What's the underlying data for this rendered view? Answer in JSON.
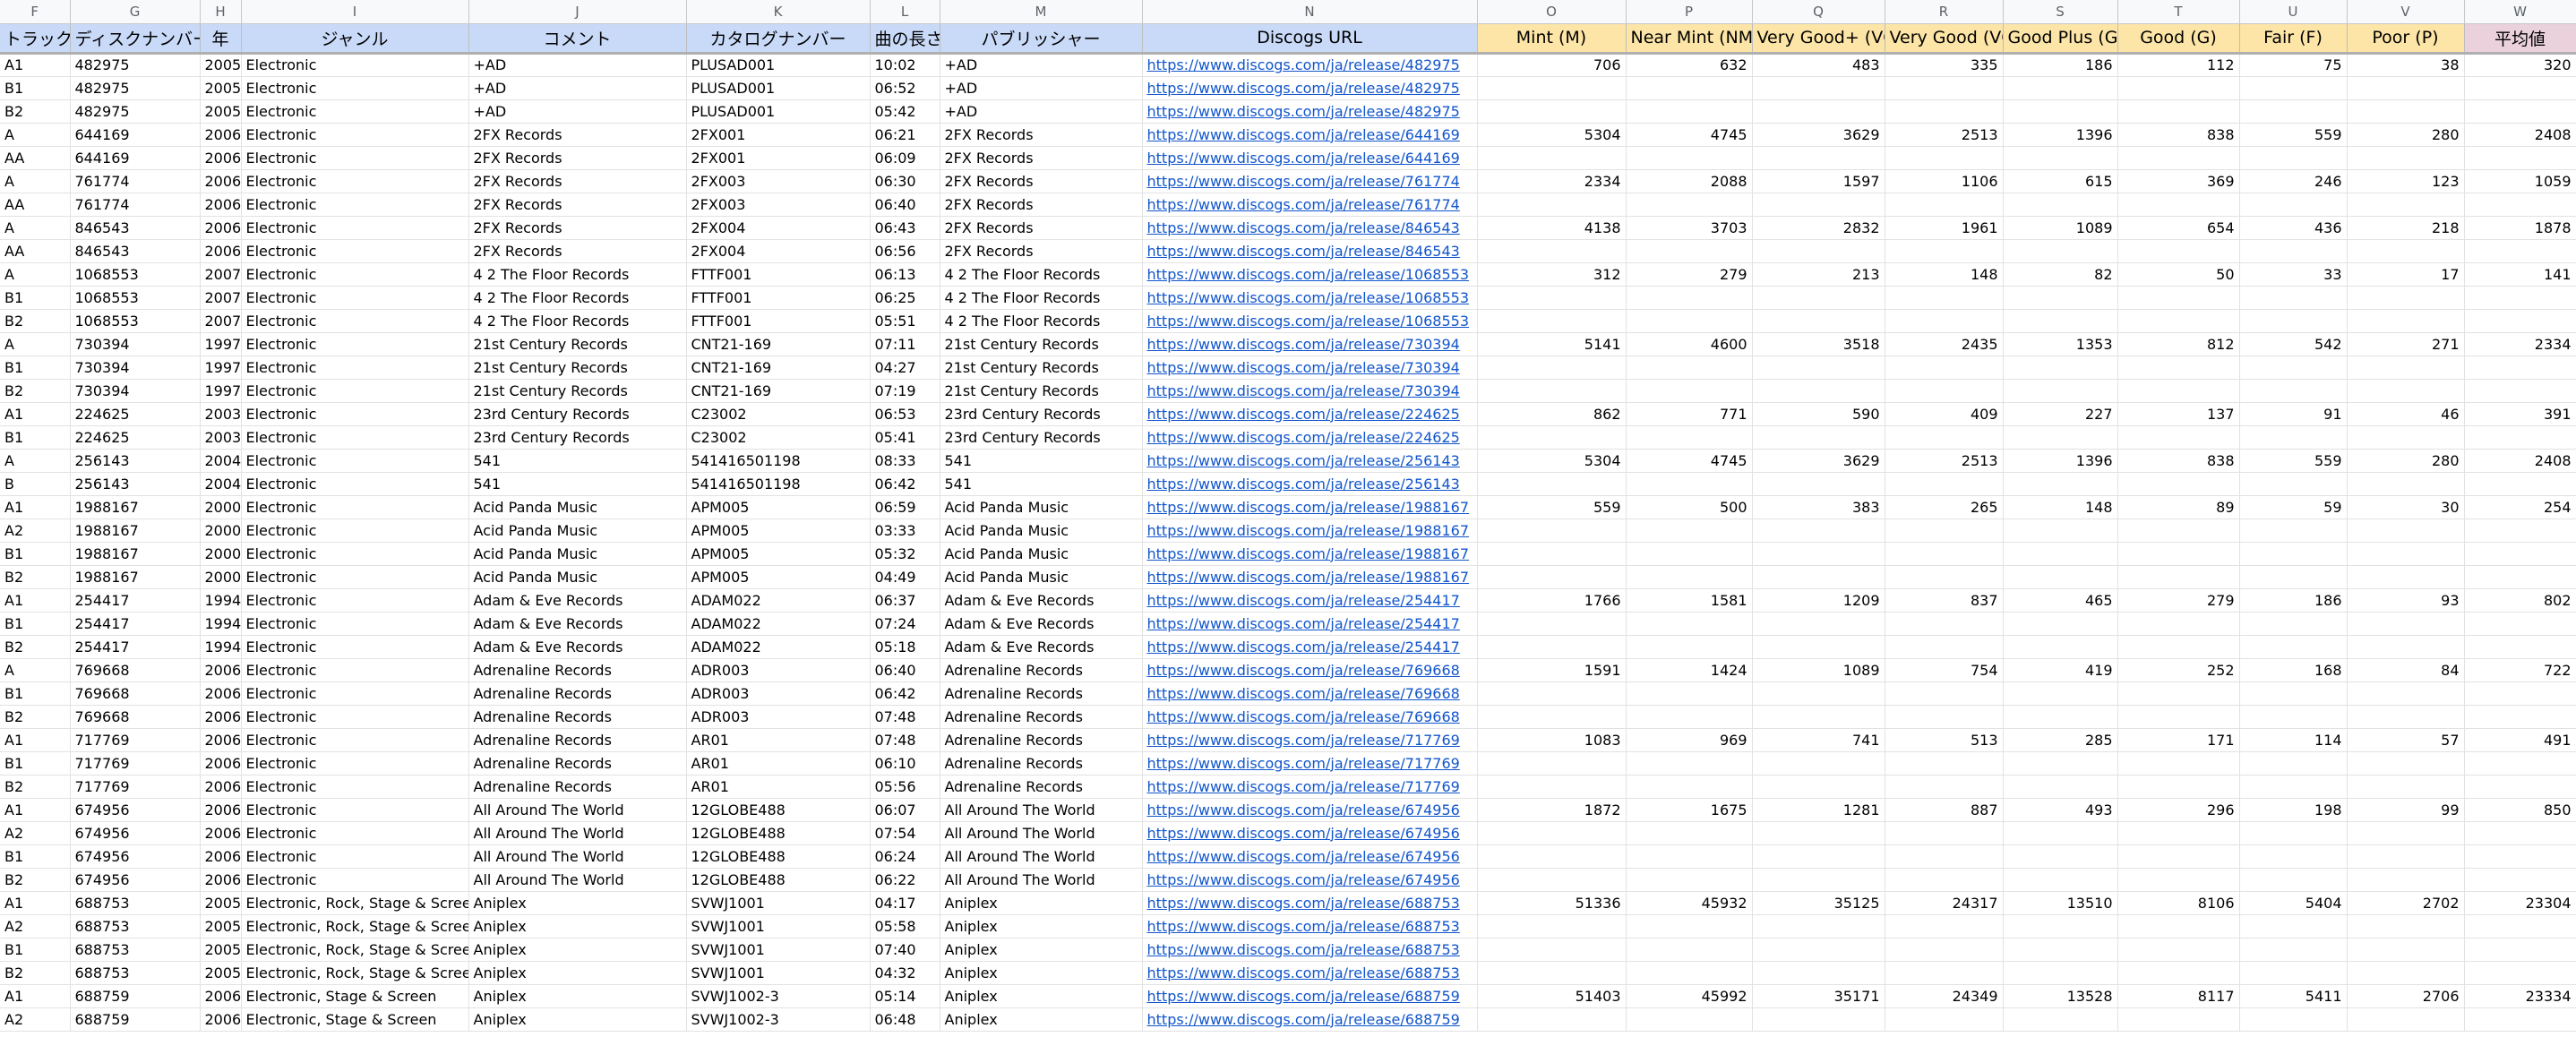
{
  "column_letters": [
    "F",
    "G",
    "H",
    "I",
    "J",
    "K",
    "L",
    "M",
    "N",
    "O",
    "P",
    "Q",
    "R",
    "S",
    "T",
    "U",
    "V",
    "W"
  ],
  "headers": [
    "トラック",
    "ディスクナンバー",
    "年",
    "ジャンル",
    "コメント",
    "カタログナンバー",
    "曲の長さ",
    "パブリッシャー",
    "Discogs URL",
    "Mint (M)",
    "Near Mint (NM)",
    "Very Good+ (VG+)",
    "Very Good (VG)",
    "Good Plus (G+)",
    "Good (G)",
    "Fair (F)",
    "Poor (P)",
    "平均値"
  ],
  "header_colors": {
    "blue": "#c9daf8",
    "orange": "#fce5a6",
    "pink": "#ead1dc",
    "link": "#1155cc"
  },
  "rows": [
    [
      "A1",
      "482975",
      "2005",
      "Electronic",
      "+AD",
      "PLUSAD001",
      "10:02",
      "+AD",
      "https://www.discogs.com/ja/release/482975",
      "706",
      "632",
      "483",
      "335",
      "186",
      "112",
      "75",
      "38",
      "320"
    ],
    [
      "B1",
      "482975",
      "2005",
      "Electronic",
      "+AD",
      "PLUSAD001",
      "06:52",
      "+AD",
      "https://www.discogs.com/ja/release/482975",
      "",
      "",
      "",
      "",
      "",
      "",
      "",
      "",
      ""
    ],
    [
      "B2",
      "482975",
      "2005",
      "Electronic",
      "+AD",
      "PLUSAD001",
      "05:42",
      "+AD",
      "https://www.discogs.com/ja/release/482975",
      "",
      "",
      "",
      "",
      "",
      "",
      "",
      "",
      ""
    ],
    [
      "A",
      "644169",
      "2006",
      "Electronic",
      "2FX Records",
      "2FX001",
      "06:21",
      "2FX Records",
      "https://www.discogs.com/ja/release/644169",
      "5304",
      "4745",
      "3629",
      "2513",
      "1396",
      "838",
      "559",
      "280",
      "2408"
    ],
    [
      "AA",
      "644169",
      "2006",
      "Electronic",
      "2FX Records",
      "2FX001",
      "06:09",
      "2FX Records",
      "https://www.discogs.com/ja/release/644169",
      "",
      "",
      "",
      "",
      "",
      "",
      "",
      "",
      ""
    ],
    [
      "A",
      "761774",
      "2006",
      "Electronic",
      "2FX Records",
      "2FX003",
      "06:30",
      "2FX Records",
      "https://www.discogs.com/ja/release/761774",
      "2334",
      "2088",
      "1597",
      "1106",
      "615",
      "369",
      "246",
      "123",
      "1059"
    ],
    [
      "AA",
      "761774",
      "2006",
      "Electronic",
      "2FX Records",
      "2FX003",
      "06:40",
      "2FX Records",
      "https://www.discogs.com/ja/release/761774",
      "",
      "",
      "",
      "",
      "",
      "",
      "",
      "",
      ""
    ],
    [
      "A",
      "846543",
      "2006",
      "Electronic",
      "2FX Records",
      "2FX004",
      "06:43",
      "2FX Records",
      "https://www.discogs.com/ja/release/846543",
      "4138",
      "3703",
      "2832",
      "1961",
      "1089",
      "654",
      "436",
      "218",
      "1878"
    ],
    [
      "AA",
      "846543",
      "2006",
      "Electronic",
      "2FX Records",
      "2FX004",
      "06:56",
      "2FX Records",
      "https://www.discogs.com/ja/release/846543",
      "",
      "",
      "",
      "",
      "",
      "",
      "",
      "",
      ""
    ],
    [
      "A",
      "1068553",
      "2007",
      "Electronic",
      "4 2 The Floor Records",
      "FTTF001",
      "06:13",
      "4 2 The Floor Records",
      "https://www.discogs.com/ja/release/1068553",
      "312",
      "279",
      "213",
      "148",
      "82",
      "50",
      "33",
      "17",
      "141"
    ],
    [
      "B1",
      "1068553",
      "2007",
      "Electronic",
      "4 2 The Floor Records",
      "FTTF001",
      "06:25",
      "4 2 The Floor Records",
      "https://www.discogs.com/ja/release/1068553",
      "",
      "",
      "",
      "",
      "",
      "",
      "",
      "",
      ""
    ],
    [
      "B2",
      "1068553",
      "2007",
      "Electronic",
      "4 2 The Floor Records",
      "FTTF001",
      "05:51",
      "4 2 The Floor Records",
      "https://www.discogs.com/ja/release/1068553",
      "",
      "",
      "",
      "",
      "",
      "",
      "",
      "",
      ""
    ],
    [
      "A",
      "730394",
      "1997",
      "Electronic",
      "21st Century Records",
      "CNT21-169",
      "07:11",
      "21st Century Records",
      "https://www.discogs.com/ja/release/730394",
      "5141",
      "4600",
      "3518",
      "2435",
      "1353",
      "812",
      "542",
      "271",
      "2334"
    ],
    [
      "B1",
      "730394",
      "1997",
      "Electronic",
      "21st Century Records",
      "CNT21-169",
      "04:27",
      "21st Century Records",
      "https://www.discogs.com/ja/release/730394",
      "",
      "",
      "",
      "",
      "",
      "",
      "",
      "",
      ""
    ],
    [
      "B2",
      "730394",
      "1997",
      "Electronic",
      "21st Century Records",
      "CNT21-169",
      "07:19",
      "21st Century Records",
      "https://www.discogs.com/ja/release/730394",
      "",
      "",
      "",
      "",
      "",
      "",
      "",
      "",
      ""
    ],
    [
      "A1",
      "224625",
      "2003",
      "Electronic",
      "23rd Century Records",
      "C23002",
      "06:53",
      "23rd Century Records",
      "https://www.discogs.com/ja/release/224625",
      "862",
      "771",
      "590",
      "409",
      "227",
      "137",
      "91",
      "46",
      "391"
    ],
    [
      "B1",
      "224625",
      "2003",
      "Electronic",
      "23rd Century Records",
      "C23002",
      "05:41",
      "23rd Century Records",
      "https://www.discogs.com/ja/release/224625",
      "",
      "",
      "",
      "",
      "",
      "",
      "",
      "",
      ""
    ],
    [
      "A",
      "256143",
      "2004",
      "Electronic",
      "541",
      "541416501198",
      "08:33",
      "541",
      "https://www.discogs.com/ja/release/256143",
      "5304",
      "4745",
      "3629",
      "2513",
      "1396",
      "838",
      "559",
      "280",
      "2408"
    ],
    [
      "B",
      "256143",
      "2004",
      "Electronic",
      "541",
      "541416501198",
      "06:42",
      "541",
      "https://www.discogs.com/ja/release/256143",
      "",
      "",
      "",
      "",
      "",
      "",
      "",
      "",
      ""
    ],
    [
      "A1",
      "1988167",
      "2000",
      "Electronic",
      "Acid Panda Music",
      "APM005",
      "06:59",
      "Acid Panda Music",
      "https://www.discogs.com/ja/release/1988167",
      "559",
      "500",
      "383",
      "265",
      "148",
      "89",
      "59",
      "30",
      "254"
    ],
    [
      "A2",
      "1988167",
      "2000",
      "Electronic",
      "Acid Panda Music",
      "APM005",
      "03:33",
      "Acid Panda Music",
      "https://www.discogs.com/ja/release/1988167",
      "",
      "",
      "",
      "",
      "",
      "",
      "",
      "",
      ""
    ],
    [
      "B1",
      "1988167",
      "2000",
      "Electronic",
      "Acid Panda Music",
      "APM005",
      "05:32",
      "Acid Panda Music",
      "https://www.discogs.com/ja/release/1988167",
      "",
      "",
      "",
      "",
      "",
      "",
      "",
      "",
      ""
    ],
    [
      "B2",
      "1988167",
      "2000",
      "Electronic",
      "Acid Panda Music",
      "APM005",
      "04:49",
      "Acid Panda Music",
      "https://www.discogs.com/ja/release/1988167",
      "",
      "",
      "",
      "",
      "",
      "",
      "",
      "",
      ""
    ],
    [
      "A1",
      "254417",
      "1994",
      "Electronic",
      "Adam & Eve Records",
      "ADAM022",
      "06:37",
      "Adam & Eve Records",
      "https://www.discogs.com/ja/release/254417",
      "1766",
      "1581",
      "1209",
      "837",
      "465",
      "279",
      "186",
      "93",
      "802"
    ],
    [
      "B1",
      "254417",
      "1994",
      "Electronic",
      "Adam & Eve Records",
      "ADAM022",
      "07:24",
      "Adam & Eve Records",
      "https://www.discogs.com/ja/release/254417",
      "",
      "",
      "",
      "",
      "",
      "",
      "",
      "",
      ""
    ],
    [
      "B2",
      "254417",
      "1994",
      "Electronic",
      "Adam & Eve Records",
      "ADAM022",
      "05:18",
      "Adam & Eve Records",
      "https://www.discogs.com/ja/release/254417",
      "",
      "",
      "",
      "",
      "",
      "",
      "",
      "",
      ""
    ],
    [
      "A",
      "769668",
      "2006",
      "Electronic",
      "Adrenaline Records",
      "ADR003",
      "06:40",
      "Adrenaline Records",
      "https://www.discogs.com/ja/release/769668",
      "1591",
      "1424",
      "1089",
      "754",
      "419",
      "252",
      "168",
      "84",
      "722"
    ],
    [
      "B1",
      "769668",
      "2006",
      "Electronic",
      "Adrenaline Records",
      "ADR003",
      "06:42",
      "Adrenaline Records",
      "https://www.discogs.com/ja/release/769668",
      "",
      "",
      "",
      "",
      "",
      "",
      "",
      "",
      ""
    ],
    [
      "B2",
      "769668",
      "2006",
      "Electronic",
      "Adrenaline Records",
      "ADR003",
      "07:48",
      "Adrenaline Records",
      "https://www.discogs.com/ja/release/769668",
      "",
      "",
      "",
      "",
      "",
      "",
      "",
      "",
      ""
    ],
    [
      "A1",
      "717769",
      "2006",
      "Electronic",
      "Adrenaline Records",
      "AR01",
      "07:48",
      "Adrenaline Records",
      "https://www.discogs.com/ja/release/717769",
      "1083",
      "969",
      "741",
      "513",
      "285",
      "171",
      "114",
      "57",
      "491"
    ],
    [
      "B1",
      "717769",
      "2006",
      "Electronic",
      "Adrenaline Records",
      "AR01",
      "06:10",
      "Adrenaline Records",
      "https://www.discogs.com/ja/release/717769",
      "",
      "",
      "",
      "",
      "",
      "",
      "",
      "",
      ""
    ],
    [
      "B2",
      "717769",
      "2006",
      "Electronic",
      "Adrenaline Records",
      "AR01",
      "05:56",
      "Adrenaline Records",
      "https://www.discogs.com/ja/release/717769",
      "",
      "",
      "",
      "",
      "",
      "",
      "",
      "",
      ""
    ],
    [
      "A1",
      "674956",
      "2006",
      "Electronic",
      "All Around The World",
      "12GLOBE488",
      "06:07",
      "All Around The World",
      "https://www.discogs.com/ja/release/674956",
      "1872",
      "1675",
      "1281",
      "887",
      "493",
      "296",
      "198",
      "99",
      "850"
    ],
    [
      "A2",
      "674956",
      "2006",
      "Electronic",
      "All Around The World",
      "12GLOBE488",
      "07:54",
      "All Around The World",
      "https://www.discogs.com/ja/release/674956",
      "",
      "",
      "",
      "",
      "",
      "",
      "",
      "",
      ""
    ],
    [
      "B1",
      "674956",
      "2006",
      "Electronic",
      "All Around The World",
      "12GLOBE488",
      "06:24",
      "All Around The World",
      "https://www.discogs.com/ja/release/674956",
      "",
      "",
      "",
      "",
      "",
      "",
      "",
      "",
      ""
    ],
    [
      "B2",
      "674956",
      "2006",
      "Electronic",
      "All Around The World",
      "12GLOBE488",
      "06:22",
      "All Around The World",
      "https://www.discogs.com/ja/release/674956",
      "",
      "",
      "",
      "",
      "",
      "",
      "",
      "",
      ""
    ],
    [
      "A1",
      "688753",
      "2005",
      "Electronic, Rock, Stage & Screen",
      "Aniplex",
      "SVWJ1001",
      "04:17",
      "Aniplex",
      "https://www.discogs.com/ja/release/688753",
      "51336",
      "45932",
      "35125",
      "24317",
      "13510",
      "8106",
      "5404",
      "2702",
      "23304"
    ],
    [
      "A2",
      "688753",
      "2005",
      "Electronic, Rock, Stage & Screen",
      "Aniplex",
      "SVWJ1001",
      "05:58",
      "Aniplex",
      "https://www.discogs.com/ja/release/688753",
      "",
      "",
      "",
      "",
      "",
      "",
      "",
      "",
      ""
    ],
    [
      "B1",
      "688753",
      "2005",
      "Electronic, Rock, Stage & Screen",
      "Aniplex",
      "SVWJ1001",
      "07:40",
      "Aniplex",
      "https://www.discogs.com/ja/release/688753",
      "",
      "",
      "",
      "",
      "",
      "",
      "",
      "",
      ""
    ],
    [
      "B2",
      "688753",
      "2005",
      "Electronic, Rock, Stage & Screen",
      "Aniplex",
      "SVWJ1001",
      "04:32",
      "Aniplex",
      "https://www.discogs.com/ja/release/688753",
      "",
      "",
      "",
      "",
      "",
      "",
      "",
      "",
      ""
    ],
    [
      "A1",
      "688759",
      "2006",
      "Electronic, Stage & Screen",
      "Aniplex",
      "SVWJ1002-3",
      "05:14",
      "Aniplex",
      "https://www.discogs.com/ja/release/688759",
      "51403",
      "45992",
      "35171",
      "24349",
      "13528",
      "8117",
      "5411",
      "2706",
      "23334"
    ],
    [
      "A2",
      "688759",
      "2006",
      "Electronic, Stage & Screen",
      "Aniplex",
      "SVWJ1002-3",
      "06:48",
      "Aniplex",
      "https://www.discogs.com/ja/release/688759",
      "",
      "",
      "",
      "",
      "",
      "",
      "",
      "",
      ""
    ]
  ]
}
